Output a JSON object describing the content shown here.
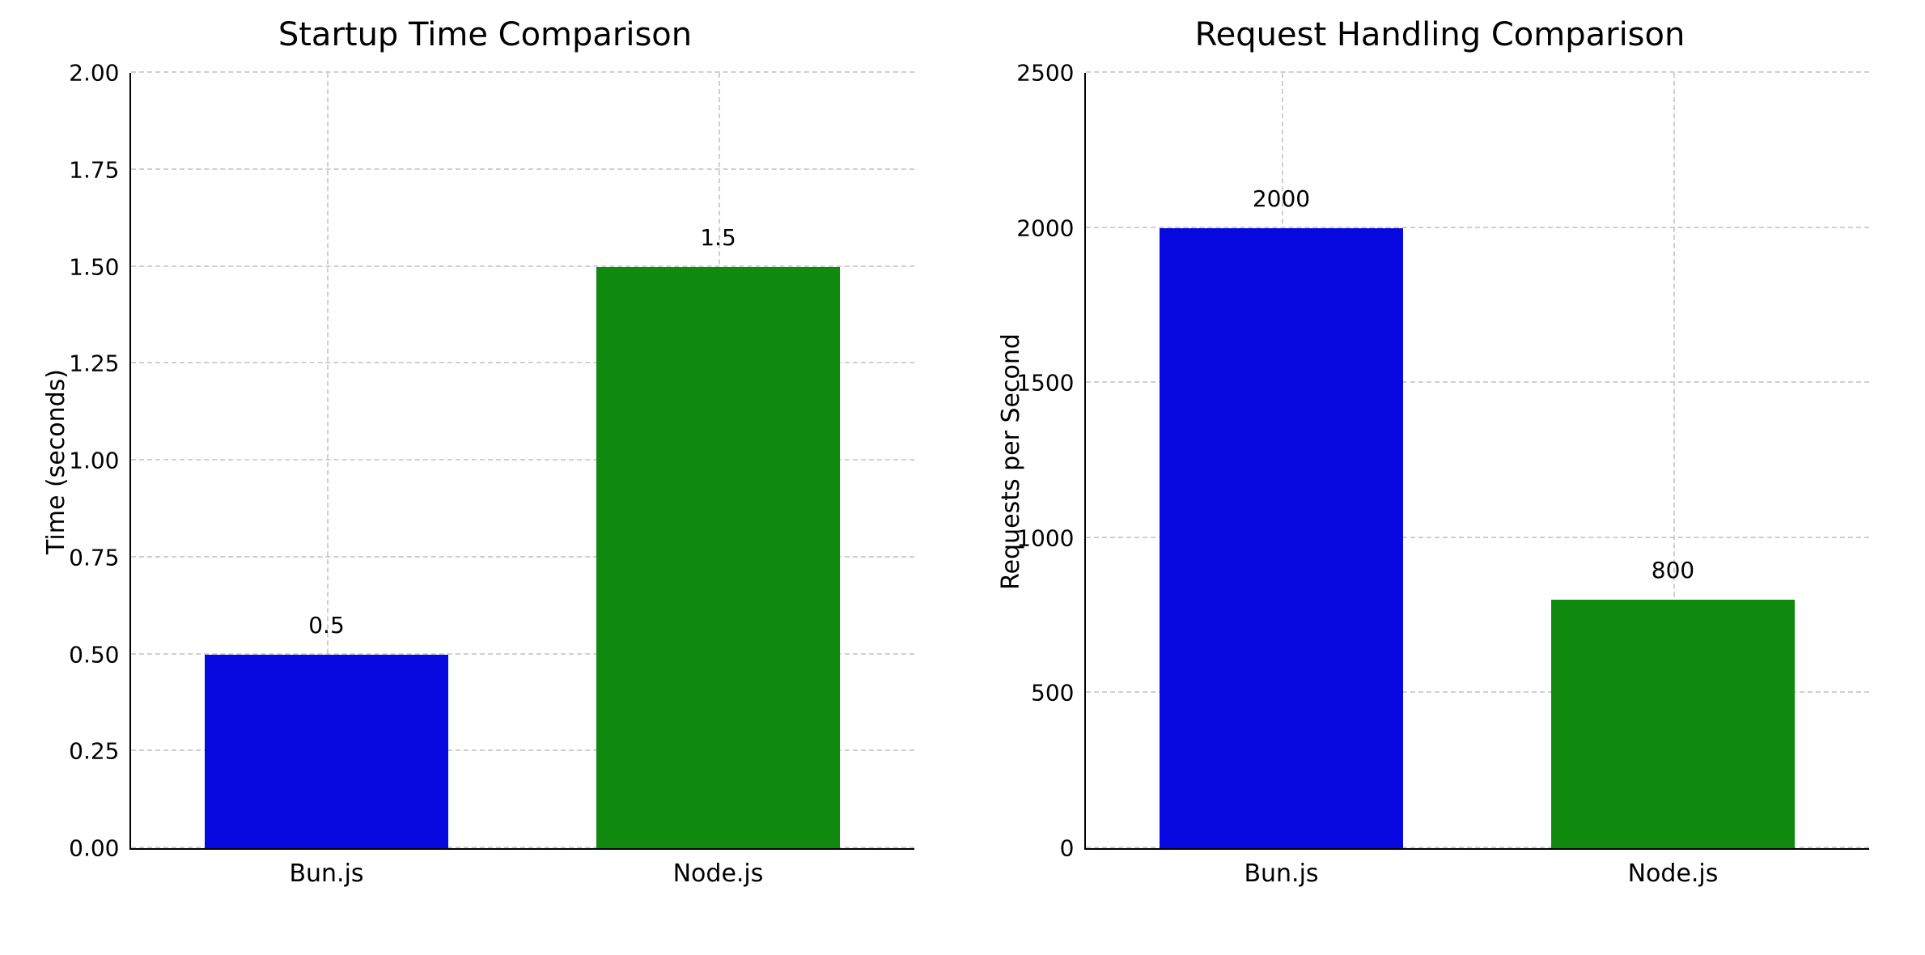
{
  "chart_data": [
    {
      "type": "bar",
      "title": "Startup Time Comparison",
      "ylabel": "Time (seconds)",
      "xlabel": "",
      "categories": [
        "Bun.js",
        "Node.js"
      ],
      "values": [
        0.5,
        1.5
      ],
      "ylim": [
        0,
        2.0
      ],
      "yticks": [
        0.0,
        0.25,
        0.5,
        0.75,
        1.0,
        1.25,
        1.5,
        1.75,
        2.0
      ],
      "ytick_labels": [
        "0.00",
        "0.25",
        "0.50",
        "0.75",
        "1.00",
        "1.25",
        "1.50",
        "1.75",
        "2.00"
      ],
      "value_labels": [
        "0.5",
        "1.5"
      ],
      "colors": [
        "#0808e0",
        "#0f8a0f"
      ]
    },
    {
      "type": "bar",
      "title": "Request Handling Comparison",
      "ylabel": "Requests per Second",
      "xlabel": "",
      "categories": [
        "Bun.js",
        "Node.js"
      ],
      "values": [
        2000,
        800
      ],
      "ylim": [
        0,
        2500
      ],
      "yticks": [
        0,
        500,
        1000,
        1500,
        2000,
        2500
      ],
      "ytick_labels": [
        "0",
        "500",
        "1000",
        "1500",
        "2000",
        "2500"
      ],
      "value_labels": [
        "2000",
        "800"
      ],
      "colors": [
        "#0808e0",
        "#0f8a0f"
      ]
    }
  ]
}
